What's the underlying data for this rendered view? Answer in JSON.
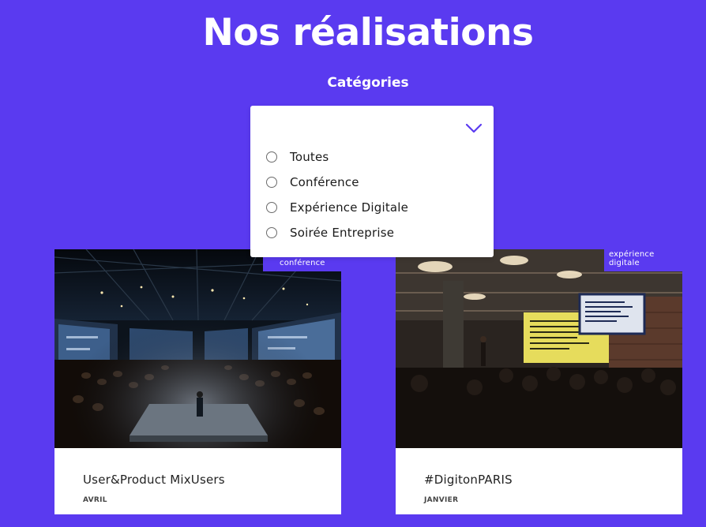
{
  "page": {
    "title": "Nos réalisations"
  },
  "filter": {
    "label": "Catégories",
    "toggle_icon": "chevron-down-icon",
    "options": [
      {
        "label": "Toutes"
      },
      {
        "label": "Conférence"
      },
      {
        "label": "Expérience Digitale"
      },
      {
        "label": "Soirée Entreprise"
      }
    ]
  },
  "cards": [
    {
      "tag": "conférence",
      "title": "User&Product MixUsers",
      "date": "AVRIL"
    },
    {
      "tag": "expérience digitale",
      "title": "#DigitonPARIS",
      "date": "JANVIER"
    }
  ],
  "colors": {
    "background": "#5a3af0",
    "card": "#ffffff",
    "tag": "#5a3af0",
    "chevron": "#5a3af0"
  }
}
